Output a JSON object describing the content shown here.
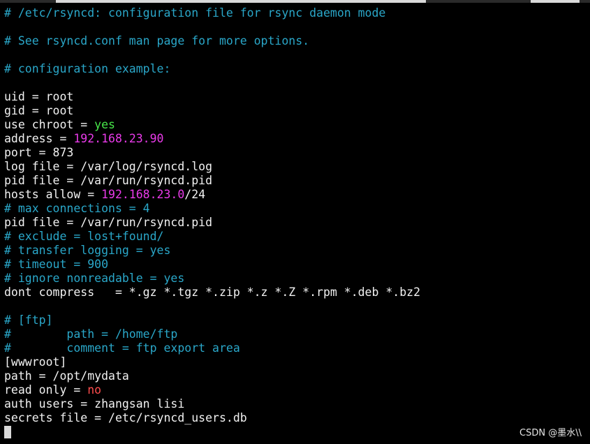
{
  "terminal": {
    "lines": [
      {
        "parts": [
          {
            "t": "# /etc/rsyncd: configuration file for rsync daemon mode",
            "c": "comment"
          }
        ]
      },
      {
        "parts": []
      },
      {
        "parts": [
          {
            "t": "# See rsyncd.conf man page for more options.",
            "c": "comment"
          }
        ]
      },
      {
        "parts": []
      },
      {
        "parts": [
          {
            "t": "# configuration example:",
            "c": "comment"
          }
        ]
      },
      {
        "parts": []
      },
      {
        "parts": [
          {
            "t": "uid = root",
            "c": "white"
          }
        ]
      },
      {
        "parts": [
          {
            "t": "gid = root",
            "c": "white"
          }
        ]
      },
      {
        "parts": [
          {
            "t": "use chroot = ",
            "c": "white"
          },
          {
            "t": "yes",
            "c": "green"
          }
        ]
      },
      {
        "parts": [
          {
            "t": "address = ",
            "c": "white"
          },
          {
            "t": "192.168.23.90",
            "c": "magenta"
          }
        ]
      },
      {
        "parts": [
          {
            "t": "port = 873",
            "c": "white"
          }
        ]
      },
      {
        "parts": [
          {
            "t": "log file = /var/log/rsyncd.log",
            "c": "white"
          }
        ]
      },
      {
        "parts": [
          {
            "t": "pid file = /var/run/rsyncd.pid",
            "c": "white"
          }
        ]
      },
      {
        "parts": [
          {
            "t": "hosts allow = ",
            "c": "white"
          },
          {
            "t": "192.168.23.0",
            "c": "magenta"
          },
          {
            "t": "/24",
            "c": "white"
          }
        ]
      },
      {
        "parts": [
          {
            "t": "# max connections = 4",
            "c": "comment"
          }
        ]
      },
      {
        "parts": [
          {
            "t": "pid file = /var/run/rsyncd.pid",
            "c": "white"
          }
        ]
      },
      {
        "parts": [
          {
            "t": "# exclude = lost+found/",
            "c": "comment"
          }
        ]
      },
      {
        "parts": [
          {
            "t": "# transfer logging = yes",
            "c": "comment"
          }
        ]
      },
      {
        "parts": [
          {
            "t": "# timeout = 900",
            "c": "comment"
          }
        ]
      },
      {
        "parts": [
          {
            "t": "# ignore nonreadable = yes",
            "c": "comment"
          }
        ]
      },
      {
        "parts": [
          {
            "t": "dont compress   = *.gz *.tgz *.zip *.z *.Z *.rpm *.deb *.bz2",
            "c": "white"
          }
        ]
      },
      {
        "parts": []
      },
      {
        "parts": [
          {
            "t": "# [ftp]",
            "c": "comment"
          }
        ]
      },
      {
        "parts": [
          {
            "t": "#        path = /home/ftp",
            "c": "comment"
          }
        ]
      },
      {
        "parts": [
          {
            "t": "#        comment = ftp export area",
            "c": "comment"
          }
        ]
      },
      {
        "parts": [
          {
            "t": "[wwwroot]",
            "c": "white"
          }
        ]
      },
      {
        "parts": [
          {
            "t": "path = /opt/mydata",
            "c": "white"
          }
        ]
      },
      {
        "parts": [
          {
            "t": "read only = ",
            "c": "white"
          },
          {
            "t": "no",
            "c": "red"
          }
        ]
      },
      {
        "parts": [
          {
            "t": "auth users = zhangsan lisi",
            "c": "white"
          }
        ]
      },
      {
        "parts": [
          {
            "t": "secrets file = /etc/rsyncd_users.db",
            "c": "white"
          }
        ]
      }
    ]
  },
  "watermark": "CSDN @墨水\\\\",
  "colors": {
    "background": "#000000",
    "comment": "#2aa7c9",
    "text": "#f2f2f2",
    "keyword_yes": "#48e84a",
    "ip_address": "#ea3bea",
    "keyword_no": "#ff4d4d"
  }
}
